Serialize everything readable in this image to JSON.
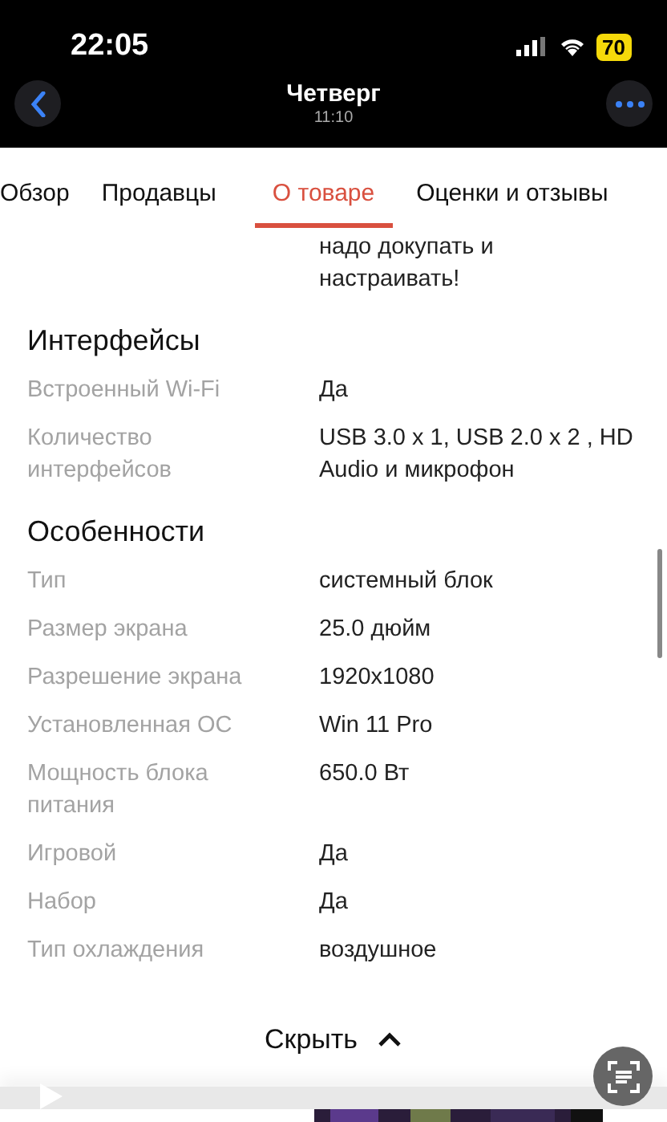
{
  "status_bar": {
    "time": "22:05",
    "battery": "70"
  },
  "header": {
    "title": "Четверг",
    "subtitle": "11:10"
  },
  "tabs": [
    {
      "label": "Обзор",
      "selected": false
    },
    {
      "label": "Продавцы",
      "selected": false
    },
    {
      "label": "О товаре",
      "selected": true
    },
    {
      "label": "Оценки и отзывы",
      "selected": false
    }
  ],
  "previous_value_tail": "надо докупать и настраивать!",
  "sections": [
    {
      "title": "Интерфейсы",
      "rows": [
        {
          "label": "Встроенный Wi-Fi",
          "value": "Да"
        },
        {
          "label": "Количество интерфейсов",
          "value": "USB 3.0 x 1, USB 2.0 x 2 , HD Audio и микрофон"
        }
      ]
    },
    {
      "title": "Особенности",
      "rows": [
        {
          "label": "Тип",
          "value": "системный блок"
        },
        {
          "label": "Размер экрана",
          "value": "25.0 дюйм"
        },
        {
          "label": "Разрешение экрана",
          "value": "1920x1080"
        },
        {
          "label": "Установленная ОС",
          "value": "Win 11 Pro"
        },
        {
          "label": "Мощность блока питания",
          "value": "650.0 Вт"
        },
        {
          "label": "Игровой",
          "value": "Да"
        },
        {
          "label": "Набор",
          "value": "Да"
        },
        {
          "label": "Тип охлаждения",
          "value": "воздушное"
        }
      ]
    }
  ],
  "collapse_button": {
    "label": "Скрыть"
  }
}
